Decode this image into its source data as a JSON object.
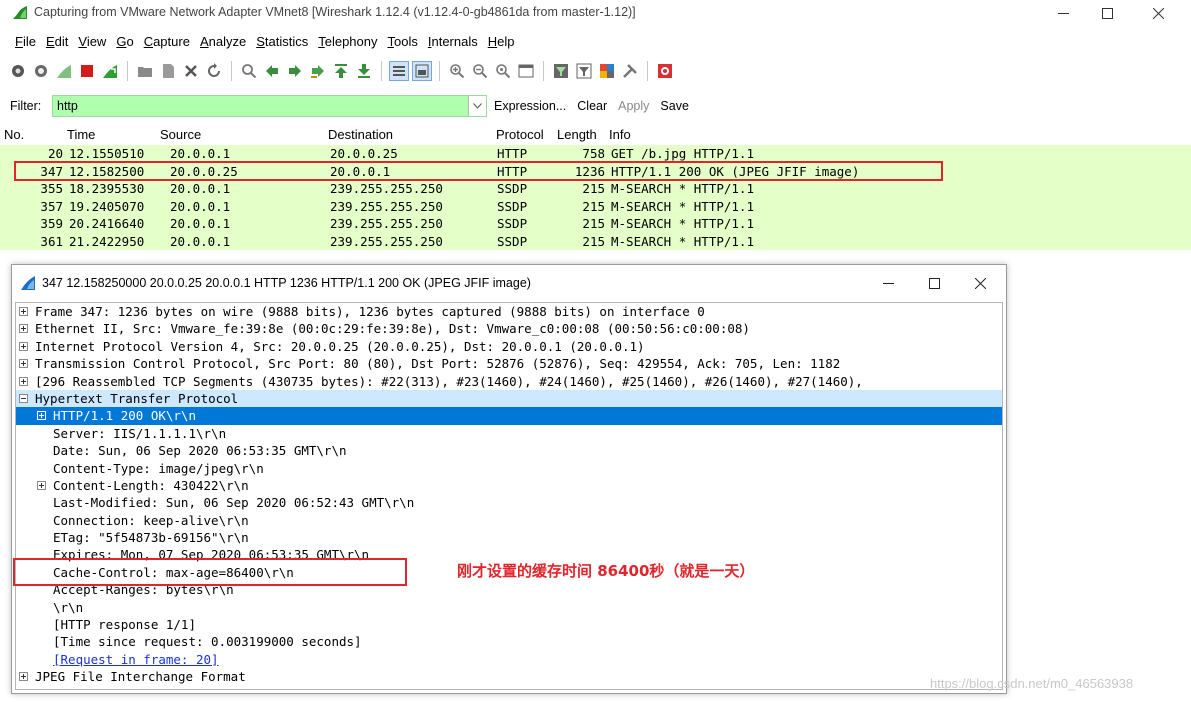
{
  "window": {
    "title": "Capturing from VMware Network Adapter VMnet8   [Wireshark 1.12.4  (v1.12.4-0-gb4861da from master-1.12)]"
  },
  "menu": [
    "File",
    "Edit",
    "View",
    "Go",
    "Capture",
    "Analyze",
    "Statistics",
    "Telephony",
    "Tools",
    "Internals",
    "Help"
  ],
  "filter": {
    "label": "Filter:",
    "value": "http",
    "expression": "Expression...",
    "clear": "Clear",
    "apply": "Apply",
    "save": "Save"
  },
  "columns": {
    "no": "No.",
    "time": "Time",
    "source": "Source",
    "destination": "Destination",
    "protocol": "Protocol",
    "length": "Length",
    "info": "Info"
  },
  "packets": [
    {
      "no": "20",
      "time": "12.1550510",
      "src": "20.0.0.1",
      "dst": "20.0.0.25",
      "proto": "HTTP",
      "len": "758",
      "info": "GET /b.jpg HTTP/1.1"
    },
    {
      "no": "347",
      "time": "12.1582500",
      "src": "20.0.0.25",
      "dst": "20.0.0.1",
      "proto": "HTTP",
      "len": "1236",
      "info": "HTTP/1.1 200 OK  (JPEG JFIF image)"
    },
    {
      "no": "355",
      "time": "18.2395530",
      "src": "20.0.0.1",
      "dst": "239.255.255.250",
      "proto": "SSDP",
      "len": "215",
      "info": "M-SEARCH * HTTP/1.1"
    },
    {
      "no": "357",
      "time": "19.2405070",
      "src": "20.0.0.1",
      "dst": "239.255.255.250",
      "proto": "SSDP",
      "len": "215",
      "info": "M-SEARCH * HTTP/1.1"
    },
    {
      "no": "359",
      "time": "20.2416640",
      "src": "20.0.0.1",
      "dst": "239.255.255.250",
      "proto": "SSDP",
      "len": "215",
      "info": "M-SEARCH * HTTP/1.1"
    },
    {
      "no": "361",
      "time": "21.2422950",
      "src": "20.0.0.1",
      "dst": "239.255.255.250",
      "proto": "SSDP",
      "len": "215",
      "info": "M-SEARCH * HTTP/1.1"
    }
  ],
  "detail": {
    "title": "347 12.158250000 20.0.0.25 20.0.0.1 HTTP 1236 HTTP/1.1 200 OK  (JPEG JFIF image)",
    "lines": [
      "Frame 347: 1236 bytes on wire (9888 bits), 1236 bytes captured (9888 bits) on interface 0",
      "Ethernet II, Src: Vmware_fe:39:8e (00:0c:29:fe:39:8e), Dst: Vmware_c0:00:08 (00:50:56:c0:00:08)",
      "Internet Protocol Version 4, Src: 20.0.0.25 (20.0.0.25), Dst: 20.0.0.1 (20.0.0.1)",
      "Transmission Control Protocol, Src Port: 80 (80), Dst Port: 52876 (52876), Seq: 429554, Ack: 705, Len: 1182",
      "[296 Reassembled TCP Segments (430735 bytes): #22(313), #23(1460), #24(1460), #25(1460), #26(1460), #27(1460),",
      "Hypertext Transfer Protocol",
      "HTTP/1.1 200 OK\\r\\n",
      "Server: IIS/1.1.1.1\\r\\n",
      "Date: Sun, 06 Sep 2020 06:53:35 GMT\\r\\n",
      "Content-Type: image/jpeg\\r\\n",
      "Content-Length: 430422\\r\\n",
      "Last-Modified: Sun, 06 Sep 2020 06:52:43 GMT\\r\\n",
      "Connection: keep-alive\\r\\n",
      "ETag: \"5f54873b-69156\"\\r\\n",
      "Expires: Mon, 07 Sep 2020 06:53:35 GMT\\r\\n",
      "Cache-Control: max-age=86400\\r\\n",
      "Accept-Ranges: bytes\\r\\n",
      "\\r\\n",
      "[HTTP response 1/1]",
      "[Time since request: 0.003199000 seconds]",
      "[Request in frame: 20]",
      "JPEG File Interchange Format"
    ]
  },
  "annotation": "刚才设置的缓存时间 86400秒（就是一天）",
  "watermark": "https://blog.csdn.net/m0_46563938",
  "colors": {
    "http_row": "#e4ffc7",
    "filter_bg": "#afffaf",
    "selected": "#0078d7",
    "highlight": "#cde8ff",
    "annotation": "#e0252c"
  }
}
